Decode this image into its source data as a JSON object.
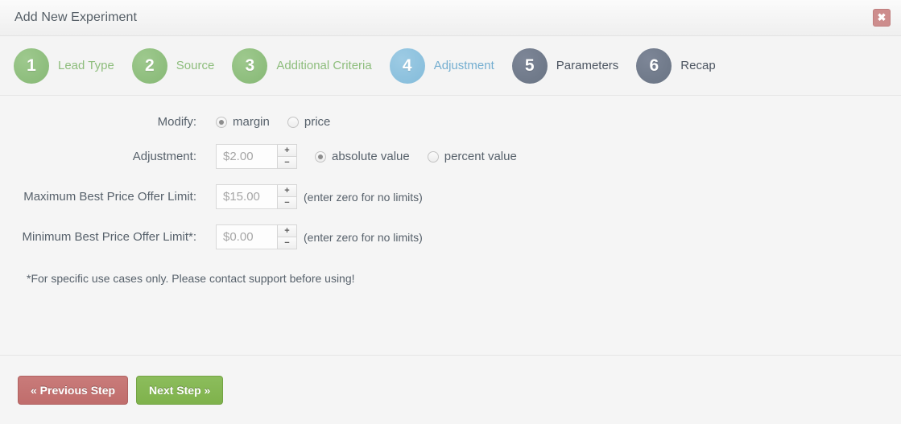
{
  "header": {
    "title": "Add New Experiment",
    "close_label": "✖"
  },
  "steps": [
    {
      "number": "1",
      "label": "Lead Type",
      "state": "done"
    },
    {
      "number": "2",
      "label": "Source",
      "state": "done"
    },
    {
      "number": "3",
      "label": "Additional Criteria",
      "state": "done"
    },
    {
      "number": "4",
      "label": "Adjustment",
      "state": "active"
    },
    {
      "number": "5",
      "label": "Parameters",
      "state": "todo"
    },
    {
      "number": "6",
      "label": "Recap",
      "state": "todo"
    }
  ],
  "form": {
    "modify": {
      "label": "Modify:",
      "options": [
        {
          "label": "margin",
          "checked": true
        },
        {
          "label": "price",
          "checked": false
        }
      ]
    },
    "adjustment": {
      "label": "Adjustment:",
      "value": "$2.00",
      "placeholder": "$0.00",
      "increment_label": "+",
      "decrement_label": "−",
      "options": [
        {
          "label": "absolute value",
          "checked": true
        },
        {
          "label": "percent value",
          "checked": false
        }
      ]
    },
    "max_limit": {
      "label": "Maximum Best Price Offer Limit:",
      "value": "$15.00",
      "placeholder": "$0.00",
      "hint": "(enter zero for no limits)",
      "increment_label": "+",
      "decrement_label": "−"
    },
    "min_limit": {
      "label": "Minimum Best Price Offer Limit*:",
      "value": "$0.00",
      "placeholder": "$0.00",
      "hint": "(enter zero for no limits)",
      "increment_label": "+",
      "decrement_label": "−"
    },
    "footnote": "*For specific use cases only. Please contact support before using!"
  },
  "footer": {
    "previous_label": "« Previous Step",
    "next_label": "Next Step »"
  },
  "colors": {
    "step_done": "#8dbd7c",
    "step_active": "#8bc0dd",
    "step_todo": "#6f7989",
    "button_previous": "#c06d6c",
    "button_next": "#7fb24c",
    "close_button": "#cd8d8d"
  }
}
